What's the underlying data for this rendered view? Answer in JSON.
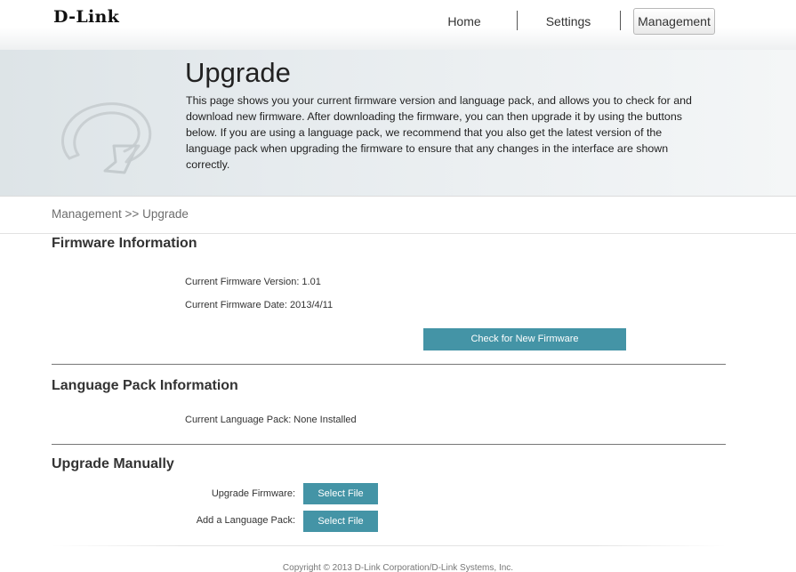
{
  "brand": {
    "logo": "D-Link"
  },
  "nav": {
    "items": [
      {
        "label": "Home"
      },
      {
        "label": "Settings"
      },
      {
        "label": "Management"
      }
    ],
    "active": "Management"
  },
  "banner": {
    "icon": "upgrade-arrows-icon",
    "title": "Upgrade",
    "description": "This page shows you your current firmware version and language pack, and allows you to check for and download new firmware. After downloading the firmware, you can then upgrade it by using the buttons below. If you are using a language pack, we recommend that you also get the latest version of the language pack when upgrading the firmware to ensure that any changes in the interface are shown correctly."
  },
  "breadcrumb": "Management >> Upgrade",
  "firmware": {
    "title": "Firmware Information",
    "version": "Current Firmware Version: 1.01",
    "date": "Current Firmware Date: 2013/4/11",
    "check_button": "Check for New Firmware"
  },
  "language_pack": {
    "title": "Language Pack Information",
    "current": "Current Language Pack: None Installed"
  },
  "manual": {
    "title": "Upgrade Manually",
    "firmware_label": "Upgrade Firmware:",
    "firmware_button": "Select File",
    "language_label": "Add a Language Pack:",
    "language_button": "Select File"
  },
  "footer": {
    "copyright": "Copyright © 2013 D-Link Corporation/D-Link Systems, Inc."
  },
  "colors": {
    "accent_button": "#4494a6",
    "banner_bg": "#e6ebee"
  }
}
